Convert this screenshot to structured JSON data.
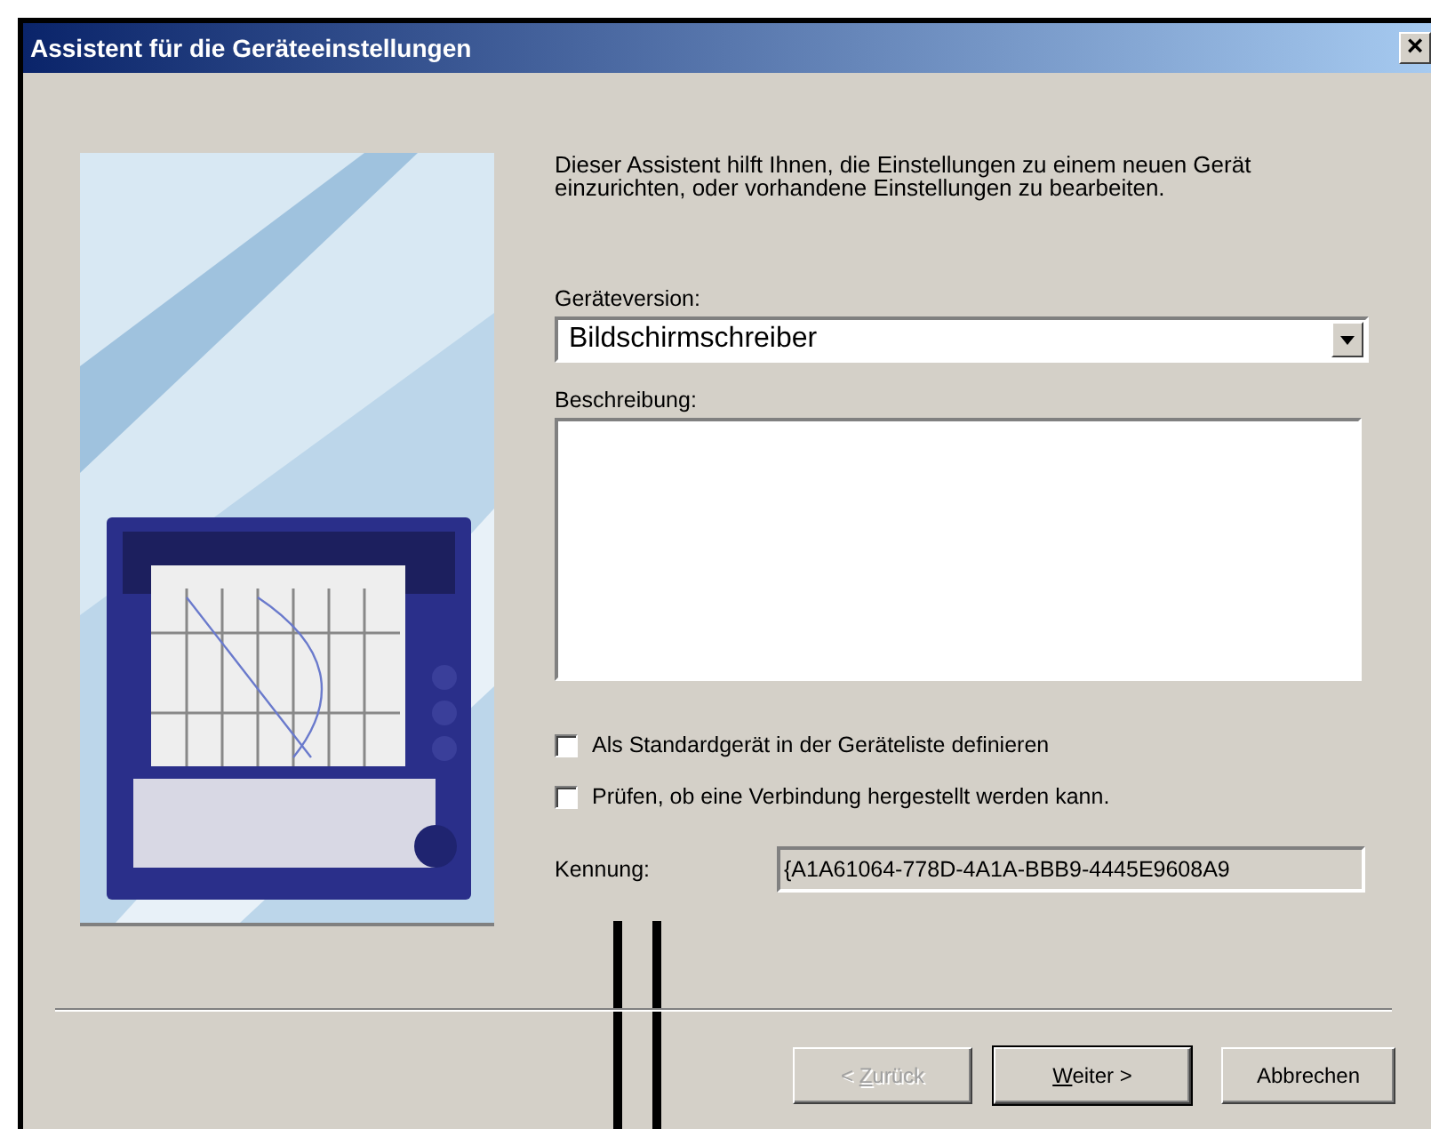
{
  "window": {
    "title": "Assistent für die Geräteeinstellungen",
    "close": "×"
  },
  "intro": "Dieser Assistent hilft Ihnen, die Einstellungen zu einem neuen Gerät einzurichten, oder vorhandene Einstellungen zu bearbeiten.",
  "version": {
    "label": "Geräteversion:",
    "value": "Bildschirmschreiber"
  },
  "description": {
    "label": "Beschreibung:"
  },
  "options": [
    {
      "label": "Als Standardgerät in der Geräteliste definieren",
      "checked": false
    },
    {
      "label": "Prüfen, ob eine Verbindung hergestellt werden kann.",
      "checked": false
    }
  ],
  "id_field": {
    "label": "Kennung:",
    "value": "{A1A61064-778D-4A1A-BBB9-4445E9608A9"
  },
  "buttons": [
    {
      "label": "< Zurück",
      "disabled": true,
      "default": false
    },
    {
      "label": "Weiter >",
      "disabled": false,
      "default": true
    },
    {
      "label": "Abbrechen",
      "disabled": false,
      "default": false
    }
  ]
}
